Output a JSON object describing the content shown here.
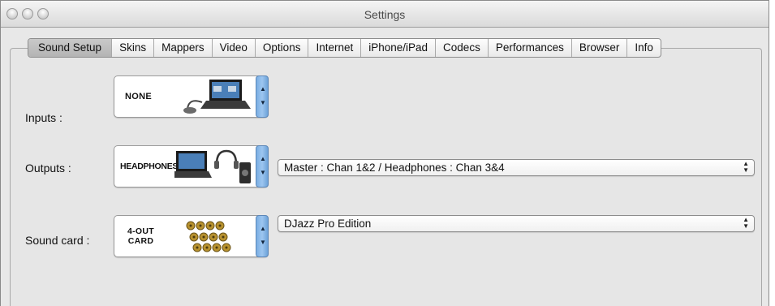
{
  "window": {
    "title": "Settings"
  },
  "tabs": [
    {
      "label": "Sound Setup",
      "active": true
    },
    {
      "label": "Skins"
    },
    {
      "label": "Mappers"
    },
    {
      "label": "Video"
    },
    {
      "label": "Options"
    },
    {
      "label": "Internet"
    },
    {
      "label": "iPhone/iPad"
    },
    {
      "label": "Codecs"
    },
    {
      "label": "Performances"
    },
    {
      "label": "Browser"
    },
    {
      "label": "Info"
    }
  ],
  "inputs": {
    "label": "Inputs :",
    "device": "NONE"
  },
  "outputs": {
    "label": "Outputs :",
    "device": "HEADPHONES",
    "routing": "Master : Chan 1&2 / Headphones : Chan 3&4"
  },
  "sound_card": {
    "label": "Sound card :",
    "device_line1": "4-OUT",
    "device_line2": "CARD",
    "selected": "DJazz Pro Edition"
  },
  "icons": {
    "up_arrow": "▲",
    "down_arrow": "▼",
    "accent": "#7aaee3"
  }
}
